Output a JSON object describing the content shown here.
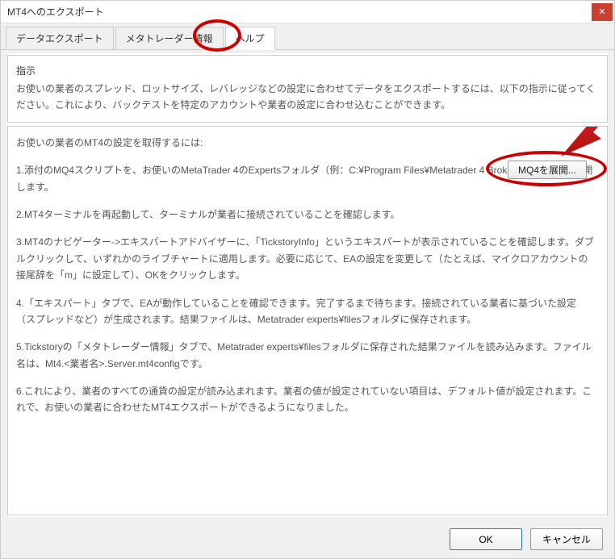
{
  "window": {
    "title": "MT4へのエクスポート"
  },
  "tabs": {
    "t1": "データエクスポート",
    "t2": "メタトレーダー情報",
    "t3": "ヘルプ"
  },
  "group_top": {
    "label": "指示",
    "body": "お使いの業者のスプレッド、ロットサイズ、レバレッジなどの設定に合わせてデータをエクスポートするには、以下の指示に従ってください。これにより、バックテストを特定のアカウントや業者の設定に合わせ込むことができます。"
  },
  "group_bottom": {
    "heading": "お使いの業者のMT4の設定を取得するには:",
    "s1": "1.添付のMQ4スクリプトを、お使いのMetaTrader 4のExpertsフォルダ（例：C:¥Program Files¥Metatrader 4 Broker¥Experts）に展開します。",
    "s2": "2.MT4ターミナルを再起動して、ターミナルが業者に接続されていることを確認します。",
    "s3": "3.MT4のナビゲーター->エキスパートアドバイザーに、「TickstoryInfo」というエキスパートが表示されていることを確認します。ダブルクリックして、いずれかのライブチャートに適用します。必要に応じて、EAの設定を変更して（たとえば、マイクロアカウントの接尾辞を「m」に設定して）、OKをクリックします。",
    "s4": "4.「エキスパート」タブで、EAが動作していることを確認できます。完了するまで待ちます。接続されている業者に基づいた設定（スプレッドなど）が生成されます。結果ファイルは、Metatrader experts¥filesフォルダに保存されます。",
    "s5": "5.Tickstoryの「メタトレーダー情報」タブで、Metatrader experts¥filesフォルダに保存された結果ファイルを読み込みます。ファイル名は、Mt4.<業者名>.Server.mt4configです。",
    "s6": "6.これにより、業者のすべての通貨の設定が読み込まれます。業者の値が設定されていない項目は、デフォルト値が設定されます。これで、お使いの業者に合わせたMT4エクスポートができるようになりました。"
  },
  "buttons": {
    "deploy": "MQ4を展開...",
    "ok": "OK",
    "cancel": "キャンセル"
  }
}
